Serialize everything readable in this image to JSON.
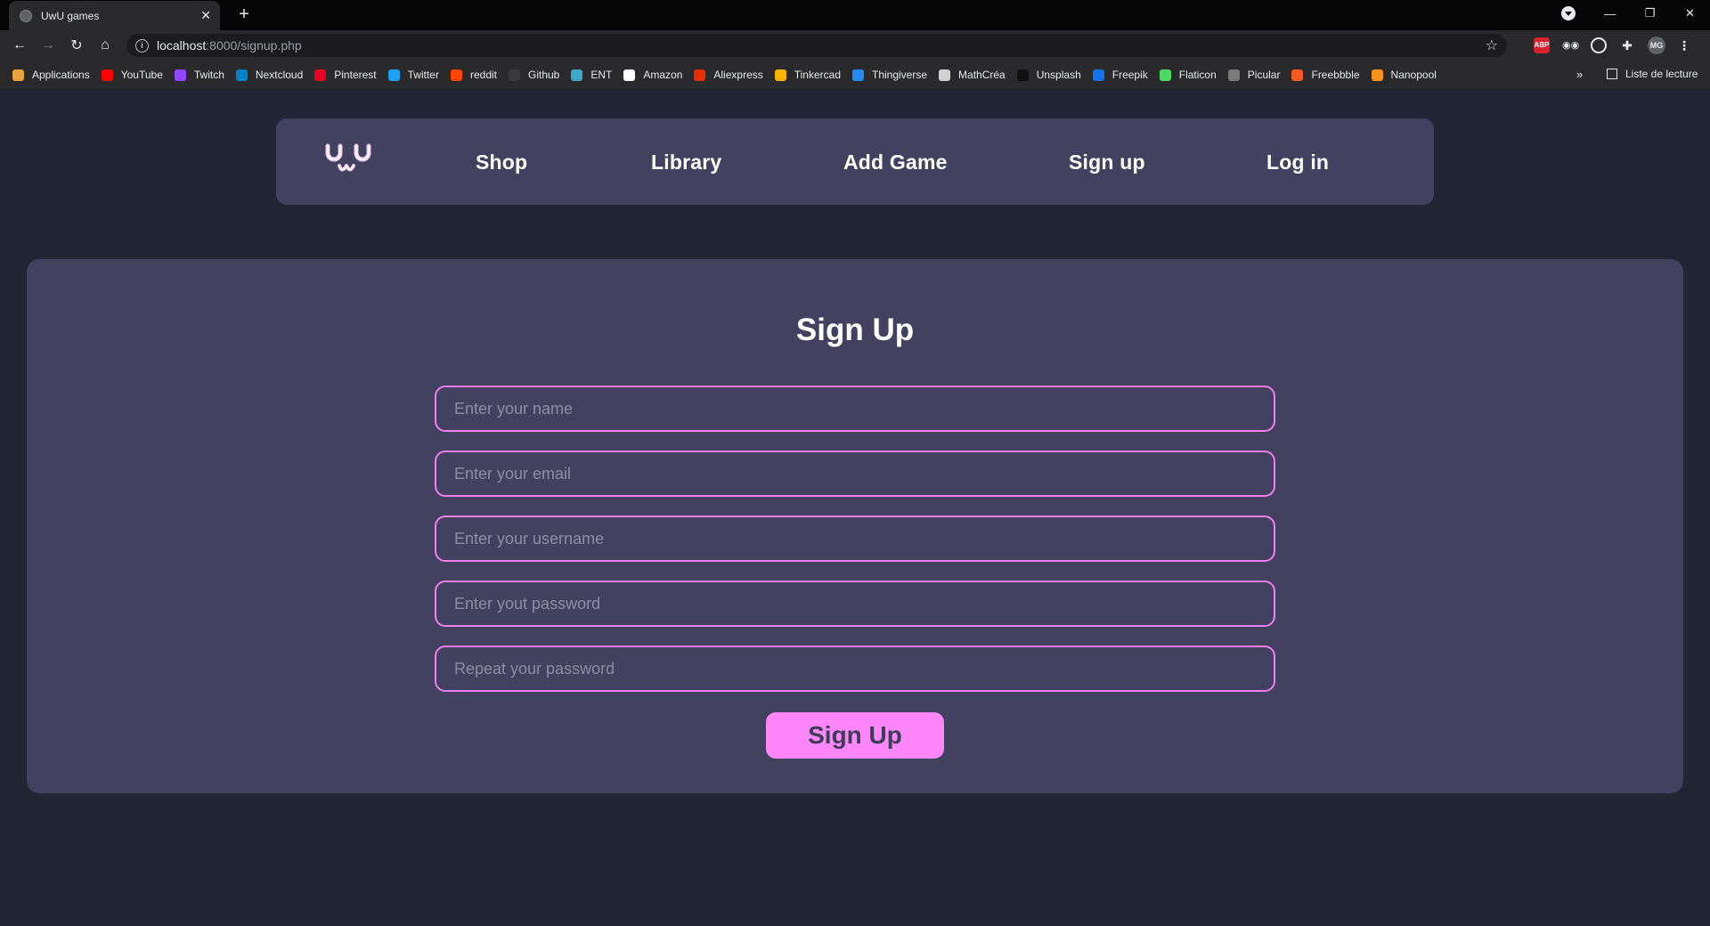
{
  "browser": {
    "tab_title": "UwU games",
    "url_host": "localhost",
    "url_path": ":8000/signup.php",
    "extensions": {
      "abp_label": "ABP",
      "avatar_initials": "MG"
    },
    "bookmarks": [
      {
        "label": "Applications",
        "icon": "apps-grid-icon",
        "color": "#e8a33d"
      },
      {
        "label": "YouTube",
        "icon": "youtube-icon",
        "color": "#ff0000"
      },
      {
        "label": "Twitch",
        "icon": "twitch-icon",
        "color": "#9146ff"
      },
      {
        "label": "Nextcloud",
        "icon": "nextcloud-icon",
        "color": "#0082c9"
      },
      {
        "label": "Pinterest",
        "icon": "pinterest-icon",
        "color": "#e60023"
      },
      {
        "label": "Twitter",
        "icon": "twitter-icon",
        "color": "#1da1f2"
      },
      {
        "label": "reddit",
        "icon": "reddit-icon",
        "color": "#ff4500"
      },
      {
        "label": "Github",
        "icon": "github-icon",
        "color": "#3a3a3a"
      },
      {
        "label": "ENT",
        "icon": "ent-icon",
        "color": "#3fa7c9"
      },
      {
        "label": "Amazon",
        "icon": "amazon-icon",
        "color": "#ffffff"
      },
      {
        "label": "Aliexpress",
        "icon": "aliexpress-icon",
        "color": "#e62e04"
      },
      {
        "label": "Tinkercad",
        "icon": "tinkercad-icon",
        "color": "#f7b500"
      },
      {
        "label": "Thingiverse",
        "icon": "thingiverse-icon",
        "color": "#248bfb"
      },
      {
        "label": "MathCréa",
        "icon": "mathcrea-icon",
        "color": "#d0d0d0"
      },
      {
        "label": "Unsplash",
        "icon": "unsplash-icon",
        "color": "#111111"
      },
      {
        "label": "Freepik",
        "icon": "freepik-icon",
        "color": "#1273eb"
      },
      {
        "label": "Flaticon",
        "icon": "flaticon-icon",
        "color": "#4cd964"
      },
      {
        "label": "Picular",
        "icon": "picular-icon",
        "color": "#7a7a7a"
      },
      {
        "label": "Freebbble",
        "icon": "freebbble-icon",
        "color": "#f25c23"
      },
      {
        "label": "Nanopool",
        "icon": "nanopool-icon",
        "color": "#f7931a"
      }
    ],
    "bookmarks_more": "»",
    "reading_list": "Liste de lecture"
  },
  "nav": {
    "links": [
      {
        "label": "Shop"
      },
      {
        "label": "Library"
      },
      {
        "label": "Add Game"
      },
      {
        "label": "Sign up"
      },
      {
        "label": "Log in"
      }
    ]
  },
  "form": {
    "title": "Sign Up",
    "fields": [
      {
        "placeholder": "Enter your name",
        "value": ""
      },
      {
        "placeholder": "Enter your email",
        "value": ""
      },
      {
        "placeholder": "Enter your username",
        "value": ""
      },
      {
        "placeholder": "Enter yout password",
        "value": ""
      },
      {
        "placeholder": "Repeat your password",
        "value": ""
      }
    ],
    "submit_label": "Sign Up"
  },
  "colors": {
    "background": "#222533",
    "panel": "#424260",
    "accent_pink": "#fd86f8",
    "field_border": "#f27ff0"
  }
}
